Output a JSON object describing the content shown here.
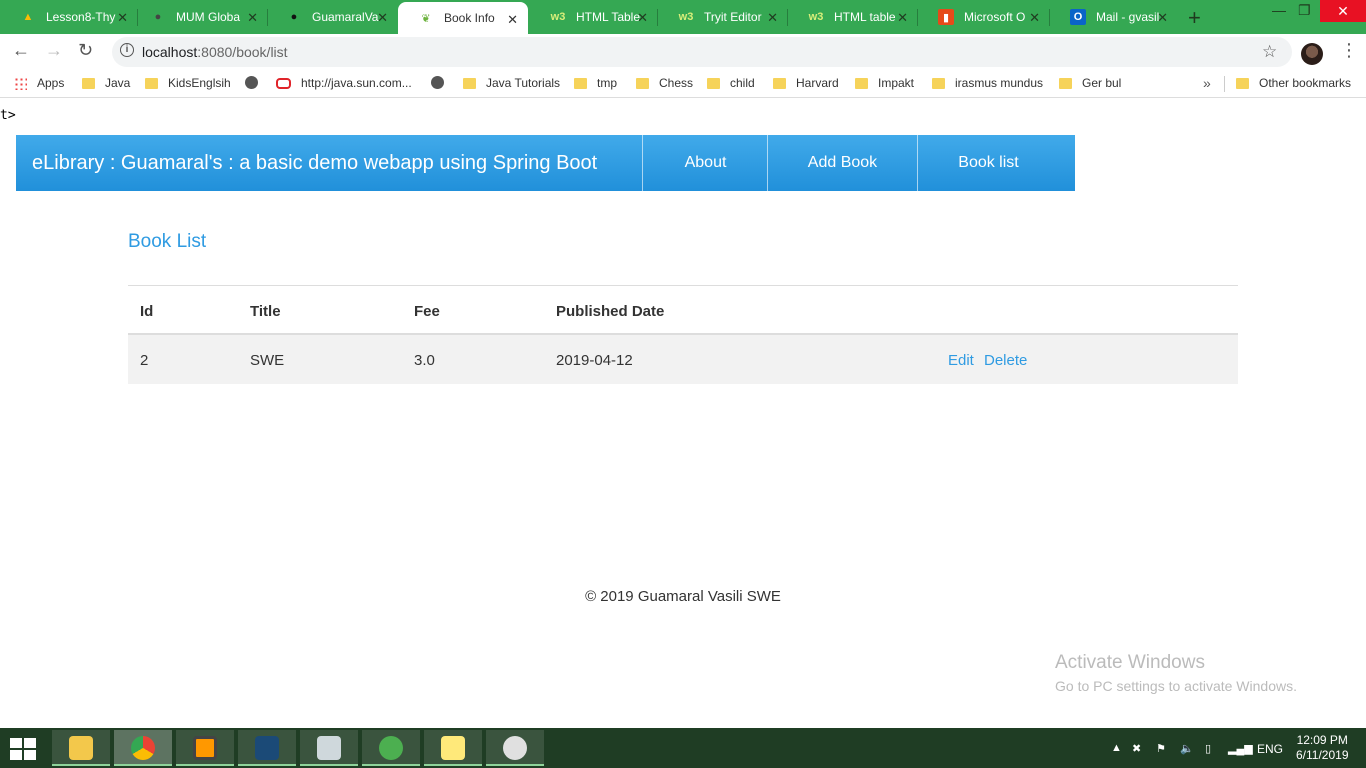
{
  "browser": {
    "tabs": [
      {
        "title": "Lesson8-Thy",
        "icon": "google-drive-icon",
        "active": false
      },
      {
        "title": "MUM Globa",
        "icon": "globe-icon",
        "active": false
      },
      {
        "title": "GuamaralVa",
        "icon": "github-icon",
        "active": false
      },
      {
        "title": "Book Info",
        "icon": "spring-leaf-icon",
        "active": true
      },
      {
        "title": "HTML Table",
        "icon": "w3schools-icon",
        "active": false
      },
      {
        "title": "Tryit Editor",
        "icon": "w3schools-icon",
        "active": false
      },
      {
        "title": "HTML table",
        "icon": "w3schools-icon",
        "active": false
      },
      {
        "title": "Microsoft O",
        "icon": "office-icon",
        "active": false
      },
      {
        "title": "Mail - gvasil",
        "icon": "outlook-icon",
        "active": false
      }
    ],
    "url_host": "localhost",
    "url_rest": ":8080/book/list",
    "bookmarks": [
      "Apps",
      "Java",
      "KidsEnglsih",
      "",
      "http://java.sun.com...",
      "",
      "Java Tutorials",
      "tmp",
      "Chess",
      "child",
      "Harvard",
      "Impakt",
      "irasmus mundus",
      "Ger bul"
    ],
    "other_bookmarks": "Other bookmarks"
  },
  "page": {
    "stray_text": "t>",
    "brand": "eLibrary : Guamaral's : a basic demo webapp using Spring Boot",
    "nav": [
      "About",
      "Add Book",
      "Book list"
    ],
    "heading": "Book List",
    "columns": [
      "Id",
      "Title",
      "Fee",
      "Published Date"
    ],
    "rows": [
      {
        "id": "2",
        "title": "SWE",
        "fee": "3.0",
        "published": "2019-04-12",
        "edit": "Edit",
        "delete": "Delete"
      }
    ],
    "footer": "© 2019 Guamaral Vasili SWE"
  },
  "os": {
    "watermark_title": "Activate Windows",
    "watermark_sub": "Go to PC settings to activate Windows.",
    "lang": "ENG",
    "time": "12:09 PM",
    "date": "6/11/2019"
  },
  "colors": {
    "tabstrip": "#35a853",
    "nav_bar": "#2f9be2",
    "link": "#2f9be2",
    "taskbar": "#1f3d24"
  }
}
